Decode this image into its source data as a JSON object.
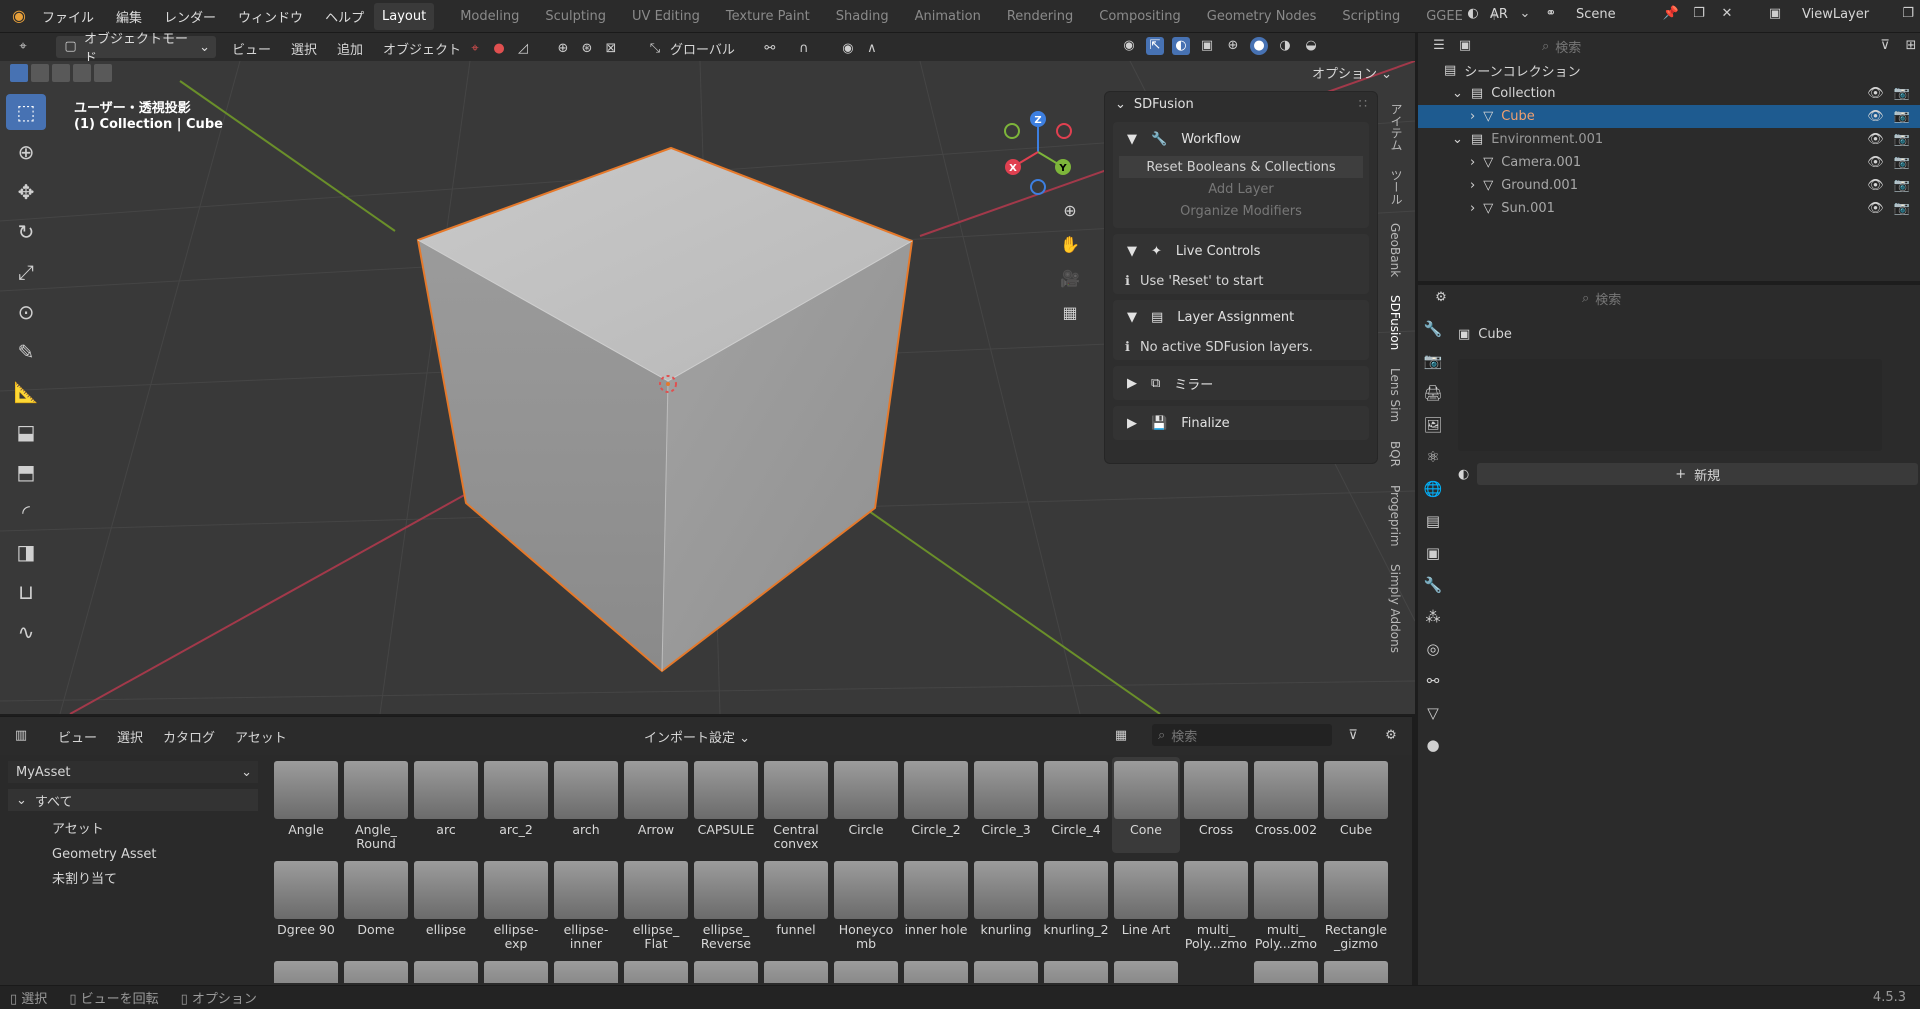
{
  "topbar": {
    "menus": [
      "ファイル",
      "編集",
      "レンダー",
      "ウィンドウ",
      "ヘルプ"
    ],
    "workspaces": [
      "Layout",
      "Modeling",
      "Sculpting",
      "UV Editing",
      "Texture Paint",
      "Shading",
      "Animation",
      "Rendering",
      "Compositing",
      "Geometry Nodes",
      "Scripting",
      "GGEE"
    ],
    "active_workspace": "Layout",
    "ar_label": "AR",
    "scene": "Scene",
    "view_layer": "ViewLayer"
  },
  "viewport_header": {
    "mode": "オブジェクトモード",
    "menus": [
      "ビュー",
      "選択",
      "追加",
      "オブジェクト"
    ],
    "transform": "グローバル",
    "options": "オプション"
  },
  "viewport": {
    "title": "ユーザー・透視投影",
    "subtitle": "(1) Collection | Cube",
    "gizmo": {
      "x": "X",
      "y": "Y",
      "z": "Z"
    }
  },
  "npanel": {
    "title": "SDFusion",
    "workflow": {
      "label": "Workflow",
      "reset": "Reset Booleans & Collections",
      "add_layer": "Add Layer",
      "organize": "Organize Modifiers"
    },
    "live": {
      "label": "Live Controls",
      "info": "Use 'Reset' to start"
    },
    "layer": {
      "label": "Layer Assignment",
      "info": "No active SDFusion layers."
    },
    "mirror": {
      "label": "ミラー"
    },
    "finalize": {
      "label": "Finalize"
    }
  },
  "vertical_tabs": [
    "アイテム",
    "ツール",
    "GeoBank",
    "SDFusion",
    "Lens Sim",
    "BQR",
    "Progeprim",
    "Simply Addons"
  ],
  "asset_browser": {
    "menus": [
      "ビュー",
      "選択",
      "カタログ",
      "アセット"
    ],
    "import_settings": "インポート設定",
    "search_placeholder": "検索",
    "library": "MyAsset",
    "catalog": {
      "all": "すべて",
      "items": [
        "アセット",
        "Geometry Asset",
        "未割り当て"
      ]
    },
    "row1": [
      "Angle",
      "Angle_\nRound",
      "arc",
      "arc_2",
      "arch",
      "Arrow",
      "CAPSULE",
      "Central\nconvex",
      "Circle",
      "Circle_2",
      "Circle_3",
      "Circle_4",
      "Cone",
      "Cross",
      "Cross.002",
      "Cube"
    ],
    "row2": [
      "Dgree 90",
      "Dome",
      "ellipse",
      "ellipse-\nexp",
      "ellipse-\ninner",
      "ellipse_\nFlat",
      "ellipse_\nReverse",
      "funnel",
      "Honeyco\nmb",
      "inner hole",
      "knurling",
      "knurling_2",
      "Line Art",
      "multi_\nPoly...zmo",
      "multi_\nPoly...zmo",
      "Rectangle\n_gizmo"
    ],
    "selected": "Cone"
  },
  "outliner": {
    "search_placeholder": "検索",
    "scene_collection": "シーンコレクション",
    "rows": [
      {
        "name": "Collection",
        "level": 1
      },
      {
        "name": "Cube",
        "level": 2,
        "selected": true
      },
      {
        "name": "Environment.001",
        "level": 1
      },
      {
        "name": "Camera.001",
        "level": 2
      },
      {
        "name": "Ground.001",
        "level": 2
      },
      {
        "name": "Sun.001",
        "level": 2
      }
    ]
  },
  "properties": {
    "search_placeholder": "検索",
    "object_name": "Cube",
    "new_button": "新規"
  },
  "status": {
    "select": "選択",
    "rotate": "ビューを回転",
    "options": "オプション",
    "version": "4.5.3"
  }
}
